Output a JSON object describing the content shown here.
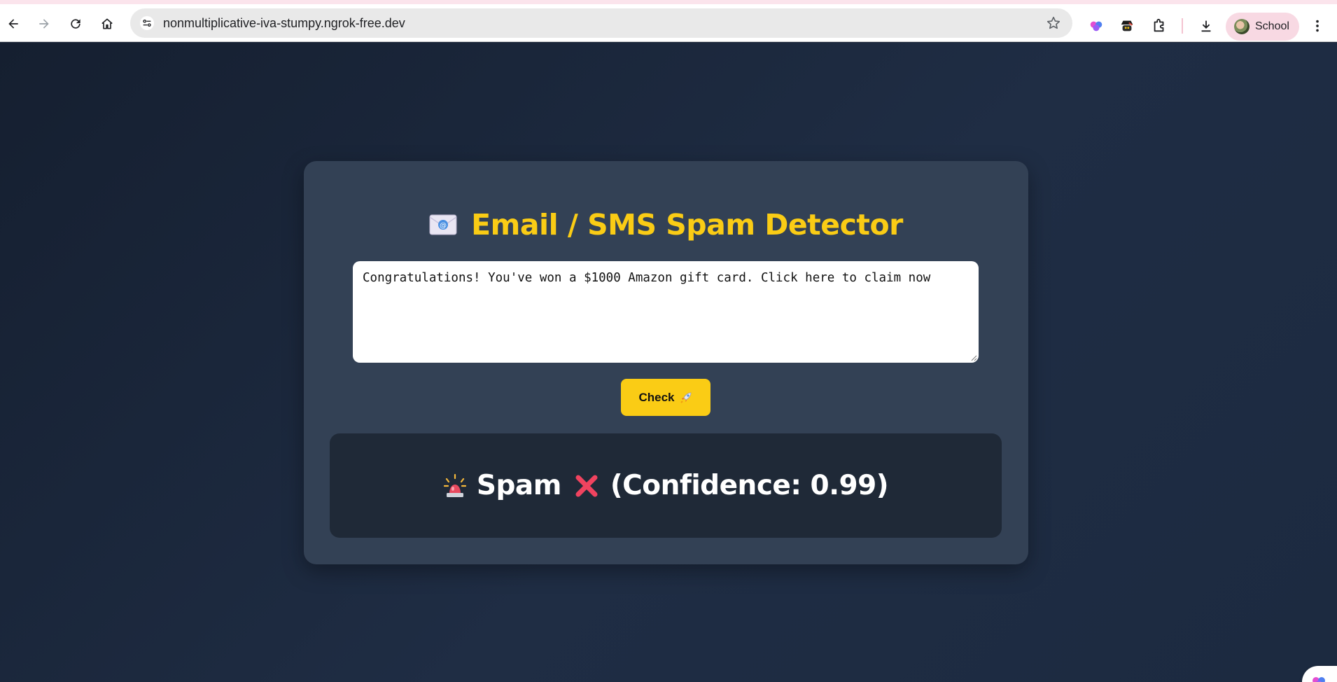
{
  "browser": {
    "url": "nonmultiplicative-iva-stumpy.ngrok-free.dev",
    "profile_name": "School",
    "icons": {
      "back": "back-arrow-icon",
      "forward": "forward-arrow-icon",
      "reload": "reload-icon",
      "home": "home-icon",
      "site_info": "tune-icon",
      "bookmark": "star-icon",
      "extensions": [
        "brain-extension-icon",
        "spy-extension-icon",
        "puzzle-extension-icon"
      ],
      "downloads": "download-icon",
      "menu": "more-vert-icon"
    }
  },
  "app": {
    "title": "Email / SMS Spam Detector",
    "message_text": "Congratulations! You've won a $1000 Amazon gift card. Click here to claim now",
    "check_label": "Check",
    "result": {
      "label": "Spam",
      "confidence_text": "(Confidence: 0.99)"
    }
  },
  "colors": {
    "accent": "#facc15",
    "card": "#334155",
    "result_bg": "#1f2937",
    "page_bg": "#1a2538"
  }
}
